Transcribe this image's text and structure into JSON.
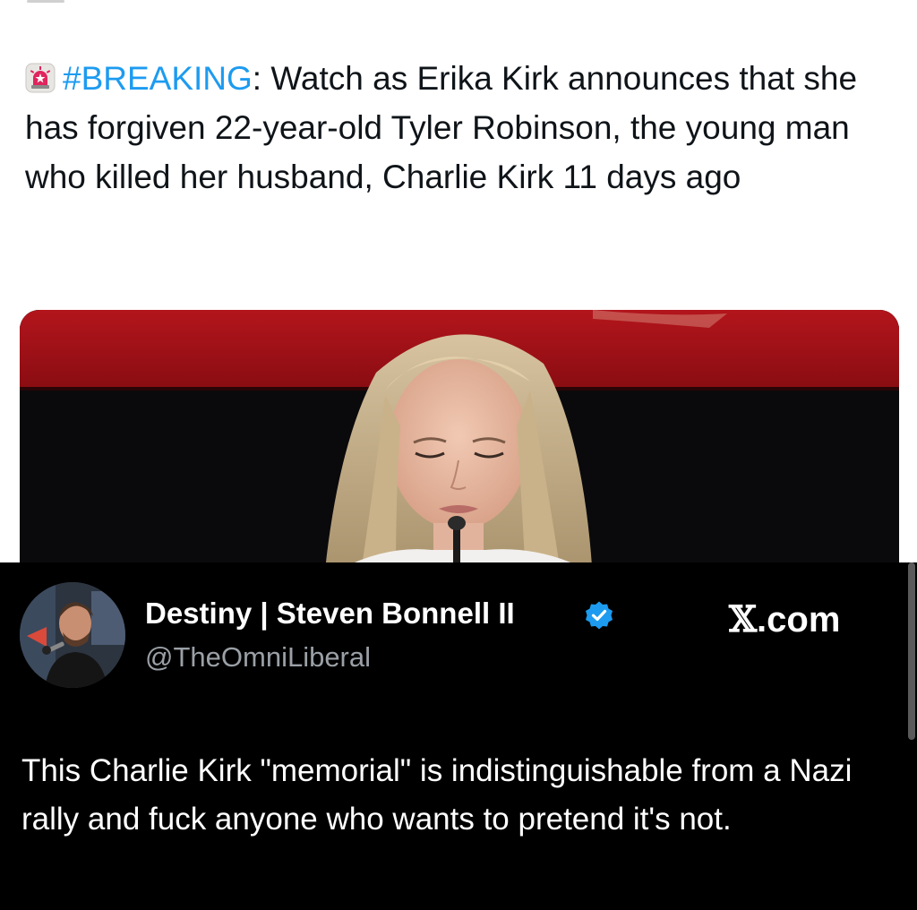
{
  "top_post": {
    "hashtag": "#BREAKING",
    "separator": ":",
    "text": " Watch as Erika Kirk announces that she has forgiven 22-year-old Tyler Robinson, the young man who killed her husband, Charlie Kirk 11 days ago",
    "icons": {
      "alert": "siren-icon"
    },
    "colors": {
      "hashtag": "#1d9bf0",
      "text": "#0f1419"
    }
  },
  "quoted_post": {
    "display_name": "Destiny | Steven Bonnell II",
    "handle": "@TheOmniLiberal",
    "site_label_glyph": "𝕏",
    "site_label_suffix": ".com",
    "body": "This Charlie Kirk \"memorial\" is indistinguishable from a Nazi rally and fuck anyone who wants to pretend it's not.",
    "icons": {
      "verified": "verified-badge-icon",
      "avatar": "avatar"
    },
    "colors": {
      "background": "#000000",
      "verified": "#1d9bf0",
      "handle": "#9aa0a6"
    }
  }
}
